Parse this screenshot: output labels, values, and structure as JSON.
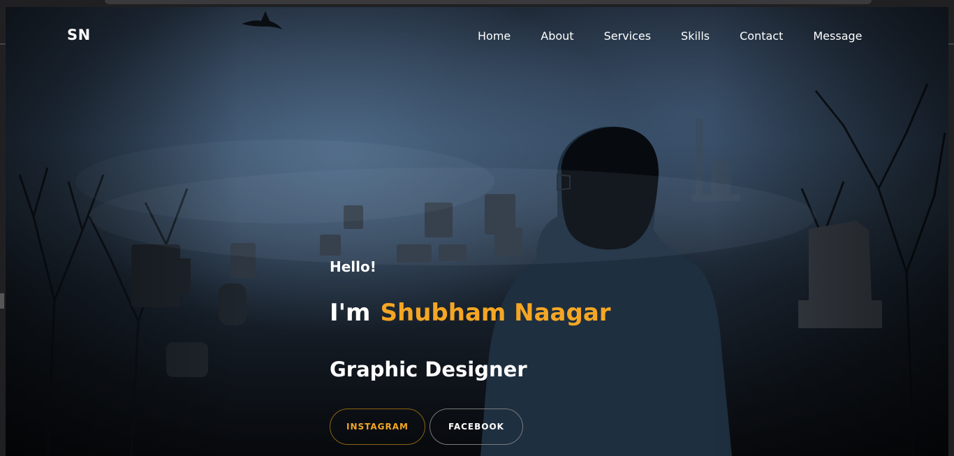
{
  "logo": {
    "text": "SN"
  },
  "nav": {
    "items": [
      {
        "label": "Home"
      },
      {
        "label": "About"
      },
      {
        "label": "Services"
      },
      {
        "label": "Skills"
      },
      {
        "label": "Contact"
      },
      {
        "label": "Message"
      }
    ]
  },
  "hero": {
    "greeting": "Hello!",
    "intro_prefix": "I'm",
    "name": "Shubham Naagar",
    "role": "Graphic Designer"
  },
  "buttons": {
    "instagram": "INSTAGRAM",
    "facebook": "FACEBOOK"
  },
  "colors": {
    "accent": "#f5a623",
    "text": "#ffffff",
    "background": "#1a2430"
  },
  "icons": {
    "bird": "crow-silhouette"
  }
}
